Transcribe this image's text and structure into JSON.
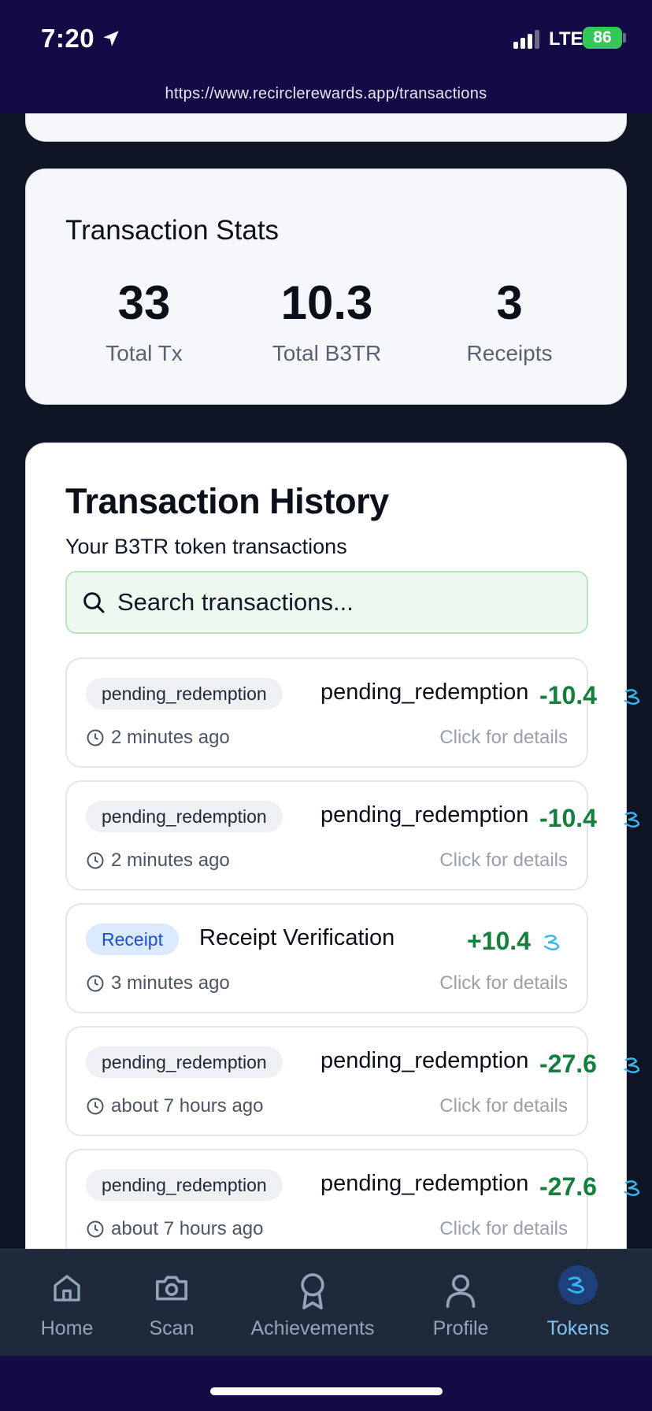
{
  "status_bar": {
    "time": "7:20",
    "network": "LTE",
    "battery": "86"
  },
  "browser": {
    "url": "https://www.recirclerewards.app/transactions"
  },
  "stats": {
    "title": "Transaction Stats",
    "items": [
      {
        "value": "33",
        "label": "Total Tx"
      },
      {
        "value": "10.3",
        "label": "Total B3TR"
      },
      {
        "value": "3",
        "label": "Receipts"
      }
    ]
  },
  "history": {
    "title": "Transaction History",
    "subtitle": "Your B3TR token transactions",
    "search_placeholder": "Search transactions...",
    "details_label": "Click for details",
    "transactions": [
      {
        "tag": "pending_redemption",
        "name": "pending_redemption",
        "amount": "-10.4",
        "time": "2 minutes ago"
      },
      {
        "tag": "pending_redemption",
        "name": "pending_redemption",
        "amount": "-10.4",
        "time": "2 minutes ago"
      },
      {
        "tag": "Receipt",
        "name": "Receipt Verification",
        "amount": "+10.4",
        "time": "3 minutes ago"
      },
      {
        "tag": "pending_redemption",
        "name": "pending_redemption",
        "amount": "-27.6",
        "time": "about 7 hours ago"
      },
      {
        "tag": "pending_redemption",
        "name": "pending_redemption",
        "amount": "-27.6",
        "time": "about 7 hours ago"
      }
    ]
  },
  "nav": {
    "items": [
      {
        "label": "Home",
        "icon": "home-icon"
      },
      {
        "label": "Scan",
        "icon": "camera-icon"
      },
      {
        "label": "Achievements",
        "icon": "award-icon"
      },
      {
        "label": "Profile",
        "icon": "user-icon"
      },
      {
        "label": "Tokens",
        "icon": "b3tr-token-icon",
        "active": true
      }
    ]
  },
  "colors": {
    "status_bar": "#130b45",
    "background": "#0f1525",
    "positive_amount": "#15803d",
    "negative_amount": "#15803d",
    "token_icon": "#38b6f0",
    "nav_active": "#7ec3f0"
  }
}
